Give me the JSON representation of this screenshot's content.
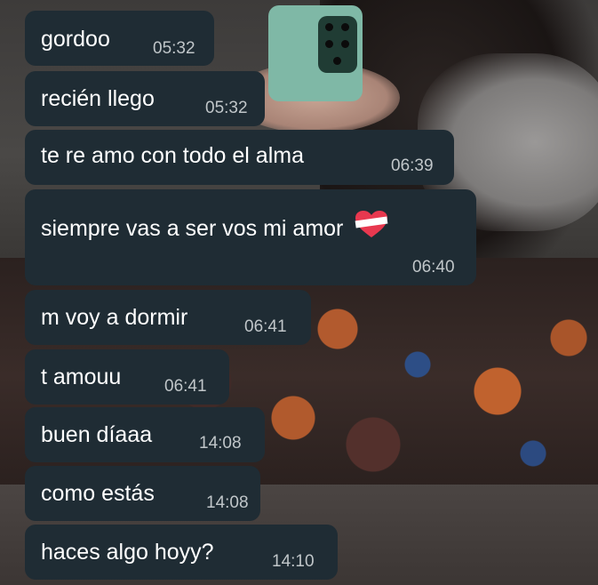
{
  "messages": [
    {
      "text": "gordoo",
      "time": "05:32"
    },
    {
      "text": "recién llego",
      "time": "05:32"
    },
    {
      "text": "te re amo con todo el alma",
      "time": "06:39"
    },
    {
      "text": "siempre vas a ser vos mi amor",
      "time": "06:40",
      "emoji": "mending-heart-icon"
    },
    {
      "text": "m voy a dormir",
      "time": "06:41"
    },
    {
      "text": "t amouu",
      "time": "06:41"
    },
    {
      "text": "buen díaaa",
      "time": "14:08"
    },
    {
      "text": "como estás",
      "time": "14:08"
    },
    {
      "text": "haces algo hoyy?",
      "time": "14:10"
    }
  ],
  "colors": {
    "bubble": "#1f2c34",
    "text": "#ffffff",
    "time": "#c0c6c9"
  }
}
